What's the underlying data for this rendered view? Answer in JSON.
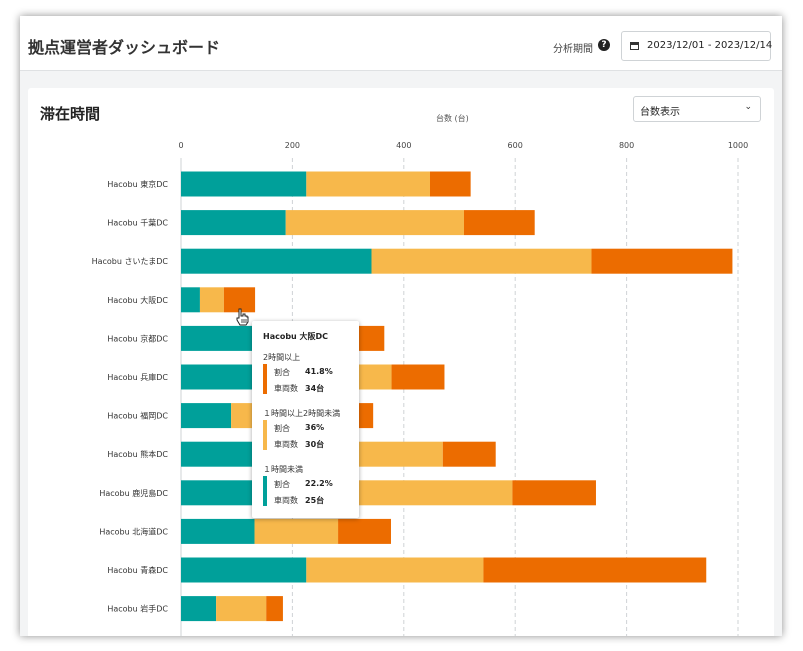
{
  "header": {
    "title": "拠点運営者ダッシュボード",
    "period_label": "分析期間",
    "help_icon": "question-circle-icon",
    "date_range": "2023/12/01 - 2023/12/14",
    "calendar_icon": "calendar-icon"
  },
  "card": {
    "title": "滞在時間",
    "select_value": "台数表示",
    "unit_label": "台数 (台)"
  },
  "colors": {
    "under_1h": "#00a09a",
    "1h_to_2h": "#f7b84b",
    "over_2h": "#ec6c00"
  },
  "chart_data": {
    "type": "bar",
    "orientation": "horizontal",
    "stacked": true,
    "xlabel": "台数 (台)",
    "xlim": [
      0,
      1000
    ],
    "x_ticks": [
      "0",
      "200",
      "400",
      "600",
      "800",
      "1000"
    ],
    "grid": true,
    "categories": [
      "Hacobu 東京DC",
      "Hacobu 千葉DC",
      "Hacobu さいたまDC",
      "Hacobu 大阪DC",
      "Hacobu 京都DC",
      "Hacobu 兵庫DC",
      "Hacobu 福岡DC",
      "Hacobu 熊本DC",
      "Hacobu 鹿児島DC",
      "Hacobu 北海道DC",
      "Hacobu 青森DC",
      "Hacobu 岩手DC"
    ],
    "series": [
      {
        "name": "1時間未満",
        "color": "#00a09a",
        "values": [
          225,
          188,
          342,
          34,
          170,
          150,
          90,
          160,
          220,
          132,
          225,
          63
        ]
      },
      {
        "name": "1時間以上2時間未満",
        "color": "#f7b84b",
        "values": [
          222,
          320,
          395,
          43,
          140,
          228,
          125,
          310,
          375,
          150,
          318,
          90
        ]
      },
      {
        "name": "2時間以上",
        "color": "#ec6c00",
        "values": [
          73,
          127,
          253,
          56,
          55,
          95,
          130,
          95,
          150,
          95,
          400,
          30
        ]
      }
    ]
  },
  "tooltip": {
    "title": "Hacobu 大阪DC",
    "sections": [
      {
        "label": "2時間以上",
        "color": "#ec6c00",
        "ratio_label": "割合",
        "ratio": "41.8%",
        "count_label": "車両数",
        "count": "34台"
      },
      {
        "label": "１時間以上2時間未満",
        "color": "#f7b84b",
        "ratio_label": "割合",
        "ratio": "36%",
        "count_label": "車両数",
        "count": "30台"
      },
      {
        "label": "１時間未満",
        "color": "#00a09a",
        "ratio_label": "割合",
        "ratio": "22.2%",
        "count_label": "車両数",
        "count": "25台"
      }
    ]
  }
}
